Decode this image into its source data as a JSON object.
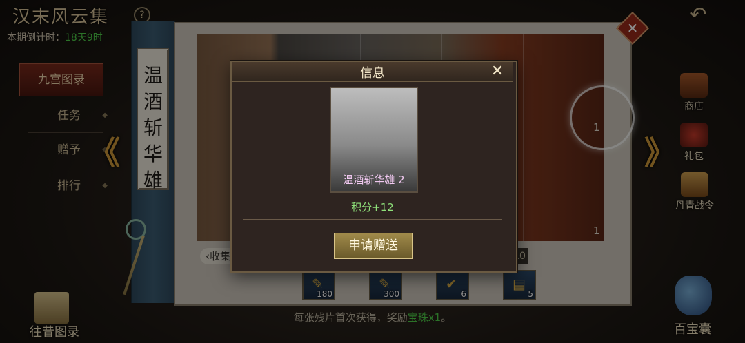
{
  "header": {
    "title": "汉末风云集",
    "help": "?",
    "countdown_label": "本期倒计时：",
    "countdown_value": "18天9时",
    "back": "↶"
  },
  "left_menu": [
    {
      "label": "九宫图录"
    },
    {
      "label": "任务"
    },
    {
      "label": "赠予"
    },
    {
      "label": "排行"
    }
  ],
  "scroll": {
    "title": "温酒斩华雄"
  },
  "puzzle": {
    "counts": [
      "1",
      "1"
    ],
    "collect_tab": "收集",
    "right_tab": "10"
  },
  "rewards": [
    {
      "count": "180",
      "icon": "reward-scroll-icon"
    },
    {
      "count": "300",
      "icon": "reward-scroll-icon"
    },
    {
      "count": "6",
      "icon": "reward-check-icon"
    },
    {
      "count": "5",
      "icon": "reward-map-icon"
    }
  ],
  "footer": {
    "prefix": "每张残片首次获得，奖励",
    "highlight": "宝珠x1",
    "suffix": "。"
  },
  "side_icons": [
    {
      "label": "商店",
      "icon": "shop-chest-icon"
    },
    {
      "label": "礼包",
      "icon": "gift-pack-icon"
    },
    {
      "label": "丹青战令",
      "icon": "battle-pass-icon"
    }
  ],
  "bottom": {
    "past": "往昔图录",
    "bag": "百宝囊"
  },
  "dialog": {
    "title": "信息",
    "close": "✕",
    "card_name": "温酒斩华雄 2",
    "score": "积分+12",
    "button": "申请赠送"
  },
  "colors": {
    "accent_green": "#4fd04a",
    "dialog_bg": "#2e2420",
    "button": "#8a7a3a"
  }
}
